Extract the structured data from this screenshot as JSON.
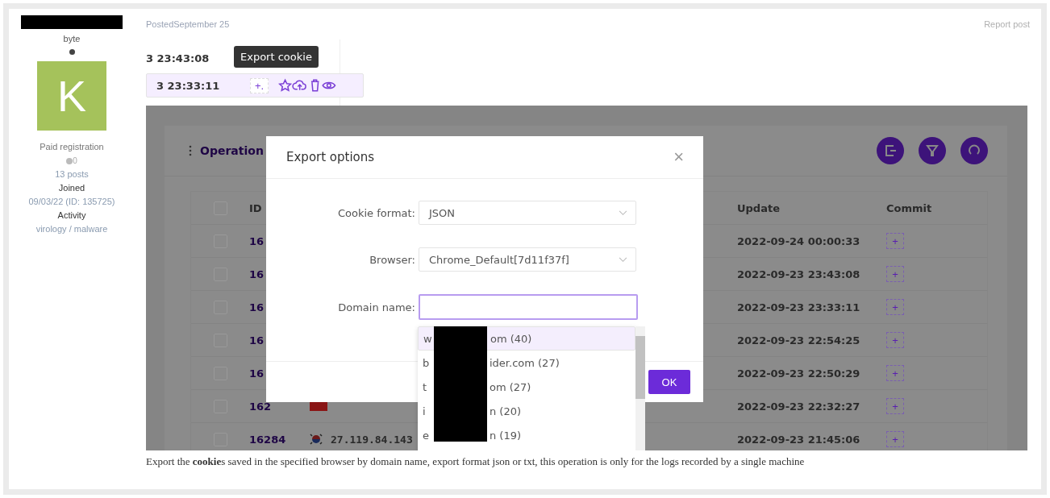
{
  "author": {
    "subtitle": "byte",
    "avatar_letter": "K",
    "group": "Paid registration",
    "reputation": "0",
    "posts": "13 posts",
    "joined_label": "Joined",
    "joined": "09/03/22 (ID: 135725)",
    "activity_label": "Activity",
    "activity": "virology / malware"
  },
  "post": {
    "posted": "PostedSeptember 25",
    "report": "Report post",
    "screenshot": {
      "top_rows": [
        {
          "time": "3 23:43:08",
          "selected": false
        },
        {
          "time": "3 23:33:11",
          "selected": true,
          "add_button": "+."
        }
      ],
      "tooltip": "Export cookie",
      "section_title": "Operation",
      "table": {
        "header_checked": false,
        "columns": [
          "ID",
          "Update",
          "Commit"
        ],
        "rows": [
          {
            "checked": false,
            "id": "16",
            "update": "2022-09-24 00:00:33",
            "commit": "+"
          },
          {
            "checked": false,
            "id": "16",
            "update": "2022-09-23 23:43:08",
            "commit": "+"
          },
          {
            "checked": false,
            "id": "16",
            "update": "2022-09-23 23:33:11",
            "commit": "+"
          },
          {
            "checked": false,
            "id": "16",
            "update": "2022-09-23 22:54:25",
            "commit": "+"
          },
          {
            "checked": false,
            "id": "16",
            "update": "2022-09-23 22:50:29",
            "commit": "+"
          },
          {
            "checked": false,
            "id": "162",
            "flag": {
              "kind": "red"
            },
            "update": "2022-09-23 22:32:27",
            "commit": "+"
          },
          {
            "checked": false,
            "id": "16284",
            "flag": {
              "kind": "taegeuk"
            },
            "ip": "27.119.84.143",
            "update": "2022-09-23 21:45:06",
            "commit": "+"
          }
        ]
      },
      "modal": {
        "title": "Export options",
        "close": "×",
        "fields": [
          {
            "kind": "select",
            "label": "Cookie format:",
            "value": "JSON"
          },
          {
            "kind": "select",
            "label": "Browser:",
            "value": "Chrome_Default[7d11f37f]"
          },
          {
            "kind": "input",
            "label": "Domain name:",
            "focused": true
          }
        ],
        "ok": "OK"
      },
      "dropdown": [
        {
          "prefix": "w",
          "suffix": "om (40)",
          "selected": true
        },
        {
          "prefix": "b",
          "suffix": "ider.com (27)",
          "selected": false
        },
        {
          "prefix": "t",
          "suffix": "om (27)",
          "selected": false
        },
        {
          "prefix": "i",
          "suffix": "n (20)",
          "selected": false
        },
        {
          "prefix": "e",
          "suffix": "n (19)",
          "selected": false
        }
      ]
    },
    "caption": "Export the **cookie**s saved in the specified browser by domain name, export format json or txt, this operation is only for the logs recorded by a single machine"
  }
}
